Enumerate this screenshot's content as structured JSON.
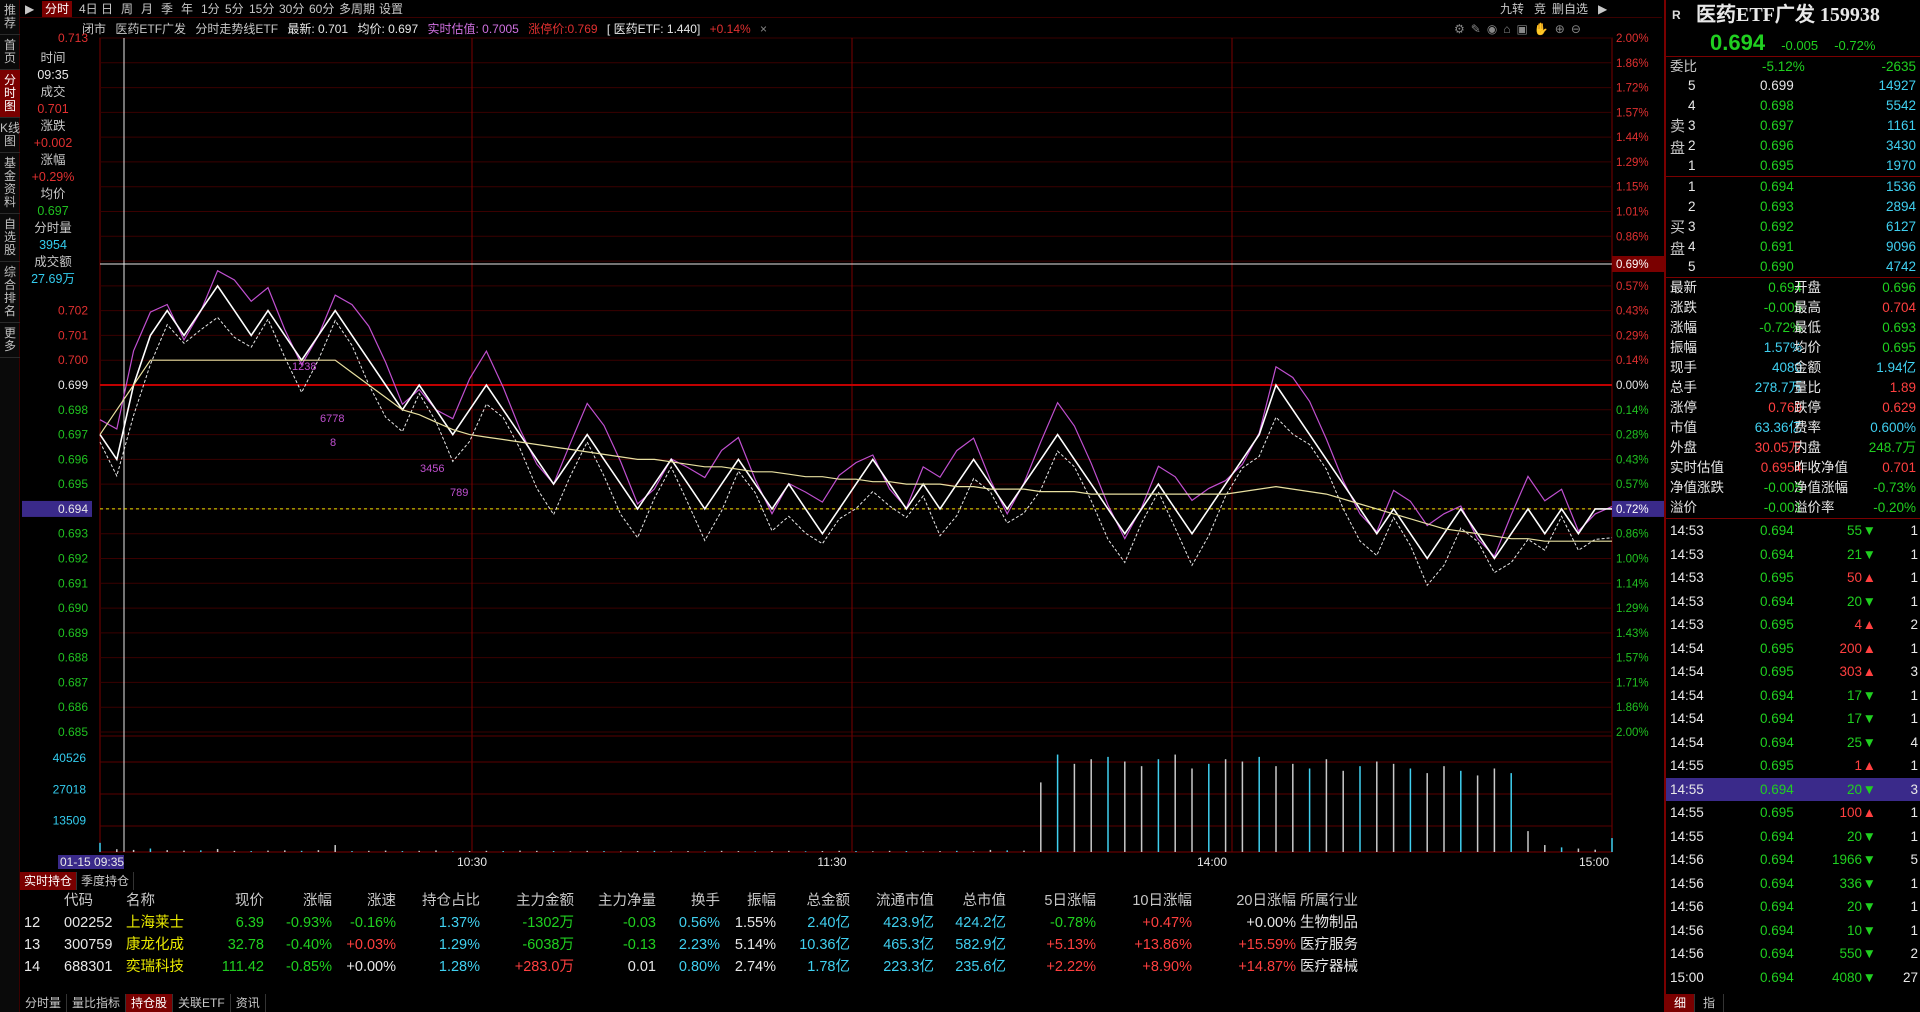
{
  "toolbar": {
    "tabs": [
      "分时",
      "4日",
      "日",
      "周",
      "月",
      "季",
      "年",
      "1分",
      "5分",
      "15分",
      "30分",
      "60分",
      "多周期",
      "设置"
    ],
    "active": "分时",
    "right": [
      "九转",
      "竞",
      "删自选"
    ]
  },
  "leftnav": [
    "推荐",
    "首页",
    "分时图",
    "K线图",
    "基金资料",
    "自选股",
    "综合排名",
    "更多"
  ],
  "info": {
    "status": "闭市",
    "name": "医药ETF广发",
    "chart_label": "分时走势线ETF",
    "latest": "最新: 0.701",
    "avg": "均价: 0.697",
    "est": "实时估值: 0.7005",
    "limit": "涨停价:0.769",
    "etf": "[ 医药ETF: 1.440]",
    "etf_chg": "+0.14%"
  },
  "sideinfo": {
    "time_label": "时间",
    "time": "09:35",
    "deal_label": "成交",
    "deal": "0.701",
    "chg_label": "涨跌",
    "chg": "+0.002",
    "pct_label": "涨幅",
    "pct": "+0.29%",
    "avg_label": "均价",
    "avg": "0.697",
    "vol_label": "分时量",
    "vol": "3954",
    "amt_label": "成交额",
    "amt": "27.69万"
  },
  "chart_data": {
    "type": "line",
    "title": "医药ETF广发 分时走势",
    "price_axis": [
      "0.713",
      "0.702",
      "0.701",
      "0.700",
      "0.699",
      "0.698",
      "0.697",
      "0.696",
      "0.695",
      "0.694",
      "0.693",
      "0.692",
      "0.691",
      "0.690",
      "0.689",
      "0.688",
      "0.687",
      "0.686",
      "0.685"
    ],
    "pct_axis": [
      "2.00%",
      "1.86%",
      "1.72%",
      "1.57%",
      "1.44%",
      "1.29%",
      "1.15%",
      "1.01%",
      "0.86%",
      "0.72%",
      "0.57%",
      "0.43%",
      "0.29%",
      "0.14%",
      "0.00%",
      "0.14%",
      "0.28%",
      "0.43%",
      "0.57%",
      "0.72%",
      "0.86%",
      "1.00%",
      "1.14%",
      "1.29%",
      "1.43%",
      "1.57%",
      "1.71%",
      "1.86%",
      "2.00%"
    ],
    "highlight_pct": "0.69%",
    "highlight_price": "0.694",
    "highlight_pct2": "0.72%",
    "vol_axis": [
      "40526",
      "27018",
      "13509"
    ],
    "x_labels": [
      "01-15 09:35",
      "10:30",
      "11:30",
      "14:00",
      "15:00"
    ],
    "prev_close": 0.699,
    "ylim": [
      0.685,
      0.713
    ],
    "annotations": [
      "1238",
      "6778",
      "8",
      "3456",
      "789"
    ],
    "price": [
      0.697,
      0.696,
      0.699,
      0.701,
      0.702,
      0.701,
      0.702,
      0.703,
      0.702,
      0.701,
      0.702,
      0.701,
      0.7,
      0.701,
      0.702,
      0.701,
      0.7,
      0.699,
      0.698,
      0.699,
      0.698,
      0.697,
      0.698,
      0.699,
      0.698,
      0.697,
      0.696,
      0.695,
      0.696,
      0.697,
      0.696,
      0.695,
      0.694,
      0.695,
      0.696,
      0.695,
      0.694,
      0.695,
      0.696,
      0.695,
      0.694,
      0.695,
      0.694,
      0.693,
      0.694,
      0.695,
      0.696,
      0.695,
      0.694,
      0.695,
      0.694,
      0.695,
      0.696,
      0.695,
      0.694,
      0.695,
      0.696,
      0.697,
      0.696,
      0.695,
      0.694,
      0.693,
      0.694,
      0.695,
      0.694,
      0.693,
      0.694,
      0.695,
      0.696,
      0.697,
      0.699,
      0.698,
      0.697,
      0.696,
      0.695,
      0.694,
      0.693,
      0.694,
      0.693,
      0.692,
      0.693,
      0.694,
      0.693,
      0.692,
      0.693,
      0.694,
      0.693,
      0.694,
      0.693,
      0.694,
      0.694
    ],
    "avg": [
      0.697,
      0.698,
      0.699,
      0.7,
      0.7,
      0.7,
      0.7,
      0.7,
      0.7,
      0.7,
      0.7,
      0.7,
      0.7,
      0.7,
      0.7,
      0.6995,
      0.699,
      0.6985,
      0.698,
      0.6978,
      0.6975,
      0.6972,
      0.697,
      0.6969,
      0.6968,
      0.6967,
      0.6966,
      0.6965,
      0.6964,
      0.6963,
      0.6962,
      0.6961,
      0.696,
      0.696,
      0.6959,
      0.6958,
      0.6957,
      0.6957,
      0.6956,
      0.6955,
      0.6955,
      0.6954,
      0.6953,
      0.6953,
      0.6952,
      0.6952,
      0.6951,
      0.6951,
      0.695,
      0.695,
      0.695,
      0.6949,
      0.6949,
      0.6948,
      0.6948,
      0.6948,
      0.6947,
      0.6947,
      0.6947,
      0.6946,
      0.6946,
      0.6946,
      0.6946,
      0.6946,
      0.6946,
      0.6946,
      0.6946,
      0.6946,
      0.6947,
      0.6948,
      0.6949,
      0.6948,
      0.6947,
      0.6946,
      0.6944,
      0.6942,
      0.694,
      0.6938,
      0.6936,
      0.6934,
      0.6932,
      0.6931,
      0.693,
      0.6929,
      0.6928,
      0.6928,
      0.6927,
      0.6927,
      0.6927,
      0.6927,
      0.6927
    ],
    "volumes": [
      3954,
      1200,
      900,
      1500,
      800,
      600,
      700,
      1300,
      500,
      400,
      600,
      700,
      500,
      800,
      3000,
      400,
      500,
      600,
      400,
      500,
      700,
      300,
      400,
      500,
      400,
      600,
      500,
      400,
      300,
      500,
      400,
      300,
      400,
      500,
      300,
      400,
      300,
      500,
      400,
      300,
      400,
      500,
      300,
      400,
      500,
      400,
      300,
      500,
      400,
      300,
      400,
      500,
      300,
      900,
      700,
      600,
      30000,
      42000,
      38000,
      40000,
      41000,
      39000,
      37000,
      40000,
      42000,
      36000,
      38000,
      40000,
      39000,
      41000,
      37000,
      38000,
      36000,
      40000,
      35000,
      37000,
      39000,
      38000,
      36000,
      34000,
      37000,
      35000,
      33000,
      36000,
      34000,
      9000,
      3000,
      2000,
      1500,
      1000,
      6000
    ]
  },
  "bottom_tabs": [
    "实时持仓",
    "季度持仓"
  ],
  "table": {
    "headers": [
      "代码",
      "名称",
      "现价",
      "涨幅",
      "涨速",
      "持仓占比",
      "主力金额",
      "主力净量",
      "换手",
      "振幅",
      "总金额",
      "流通市值",
      "总市值",
      "5日涨幅",
      "10日涨幅",
      "20日涨幅",
      "所属行业"
    ],
    "rows": [
      {
        "idx": "12",
        "code": "002252",
        "name": "上海莱士",
        "price": "6.39",
        "pct": "-0.93%",
        "speed": "-0.16%",
        "ratio": "1.37%",
        "amt": "-1302万",
        "net": "-0.03",
        "turn": "0.56%",
        "amp": "1.55%",
        "total": "2.40亿",
        "float": "423.9亿",
        "mcap": "424.2亿",
        "d5": "-0.78%",
        "d10": "+0.47%",
        "d20": "+0.00%",
        "ind": "生物制品"
      },
      {
        "idx": "13",
        "code": "300759",
        "name": "康龙化成",
        "price": "32.78",
        "pct": "-0.40%",
        "speed": "+0.03%",
        "ratio": "1.29%",
        "amt": "-6038万",
        "net": "-0.13",
        "turn": "2.23%",
        "amp": "5.14%",
        "total": "10.36亿",
        "float": "465.3亿",
        "mcap": "582.9亿",
        "d5": "+5.13%",
        "d10": "+13.86%",
        "d20": "+15.59%",
        "ind": "医疗服务"
      },
      {
        "idx": "14",
        "code": "688301",
        "name": "奕瑞科技",
        "price": "111.42",
        "pct": "-0.85%",
        "speed": "+0.00%",
        "ratio": "1.28%",
        "amt": "+283.0万",
        "net": "0.01",
        "turn": "0.80%",
        "amp": "2.74%",
        "total": "1.78亿",
        "float": "223.3亿",
        "mcap": "235.6亿",
        "d5": "+2.22%",
        "d10": "+8.90%",
        "d20": "+14.87%",
        "ind": "医疗器械"
      }
    ]
  },
  "status_tabs": [
    "分时量",
    "量比指标",
    "持仓股",
    "关联ETF",
    "资讯"
  ],
  "status_active": "持仓股",
  "right": {
    "badge": "R",
    "title": "医药ETF广发 159938",
    "price": "0.694",
    "chg": "-0.005",
    "pct": "-0.72%",
    "webi_label": "委比",
    "webi": "-5.12%",
    "webi_diff": "-2635",
    "sell_label": "卖盘",
    "buy_label": "买盘",
    "sells": [
      {
        "n": "5",
        "p": "0.699",
        "v": "14927"
      },
      {
        "n": "4",
        "p": "0.698",
        "v": "5542"
      },
      {
        "n": "3",
        "p": "0.697",
        "v": "1161"
      },
      {
        "n": "2",
        "p": "0.696",
        "v": "3430"
      },
      {
        "n": "1",
        "p": "0.695",
        "v": "1970"
      }
    ],
    "buys": [
      {
        "n": "1",
        "p": "0.694",
        "v": "1536"
      },
      {
        "n": "2",
        "p": "0.693",
        "v": "2894"
      },
      {
        "n": "3",
        "p": "0.692",
        "v": "6127"
      },
      {
        "n": "4",
        "p": "0.691",
        "v": "9096"
      },
      {
        "n": "5",
        "p": "0.690",
        "v": "4742"
      }
    ],
    "stats": [
      [
        "最新",
        "0.694",
        "开盘",
        "0.696"
      ],
      [
        "涨跌",
        "-0.005",
        "最高",
        "0.704"
      ],
      [
        "涨幅",
        "-0.72%",
        "最低",
        "0.693"
      ],
      [
        "振幅",
        "1.57%",
        "均价",
        "0.695"
      ],
      [
        "现手",
        "4080",
        "金额",
        "1.94亿"
      ],
      [
        "总手",
        "278.7万",
        "量比",
        "1.89"
      ],
      [
        "涨停",
        "0.769",
        "跌停",
        "0.629"
      ],
      [
        "市值",
        "63.36亿",
        "费率",
        "0.600%"
      ],
      [
        "外盘",
        "30.05万",
        "内盘",
        "248.7万"
      ],
      [
        "实时估值",
        "0.6954",
        "昨收净值",
        "0.701"
      ],
      [
        "净值涨跌",
        "-0.005",
        "净值涨幅",
        "-0.73%"
      ],
      [
        "溢价",
        "-0.001",
        "溢价率",
        "-0.20%"
      ]
    ],
    "ticks": [
      [
        "14:53",
        "0.694",
        "55",
        "1"
      ],
      [
        "14:53",
        "0.694",
        "21",
        "1"
      ],
      [
        "14:53",
        "0.695",
        "50",
        "1"
      ],
      [
        "14:53",
        "0.694",
        "20",
        "1"
      ],
      [
        "14:53",
        "0.695",
        "4",
        "2"
      ],
      [
        "14:54",
        "0.695",
        "200",
        "1"
      ],
      [
        "14:54",
        "0.695",
        "303",
        "3"
      ],
      [
        "14:54",
        "0.694",
        "17",
        "1"
      ],
      [
        "14:54",
        "0.694",
        "17",
        "1"
      ],
      [
        "14:54",
        "0.694",
        "25",
        "4"
      ],
      [
        "14:55",
        "0.695",
        "1",
        "1"
      ],
      [
        "14:55",
        "0.694",
        "20",
        "3"
      ],
      [
        "14:55",
        "0.695",
        "100",
        "1"
      ],
      [
        "14:55",
        "0.694",
        "20",
        "1"
      ],
      [
        "14:56",
        "0.694",
        "1966",
        "5"
      ],
      [
        "14:56",
        "0.694",
        "336",
        "1"
      ],
      [
        "14:56",
        "0.694",
        "20",
        "1"
      ],
      [
        "14:56",
        "0.694",
        "10",
        "1"
      ],
      [
        "14:56",
        "0.694",
        "550",
        "2"
      ],
      [
        "15:00",
        "0.694",
        "4080",
        "27"
      ]
    ],
    "tick_dirs": [
      "down",
      "down",
      "up",
      "down",
      "up",
      "up",
      "up",
      "down",
      "down",
      "down",
      "up",
      "down",
      "up",
      "down",
      "down",
      "down",
      "down",
      "down",
      "down",
      "down"
    ],
    "bottom": [
      "细",
      "指"
    ]
  }
}
